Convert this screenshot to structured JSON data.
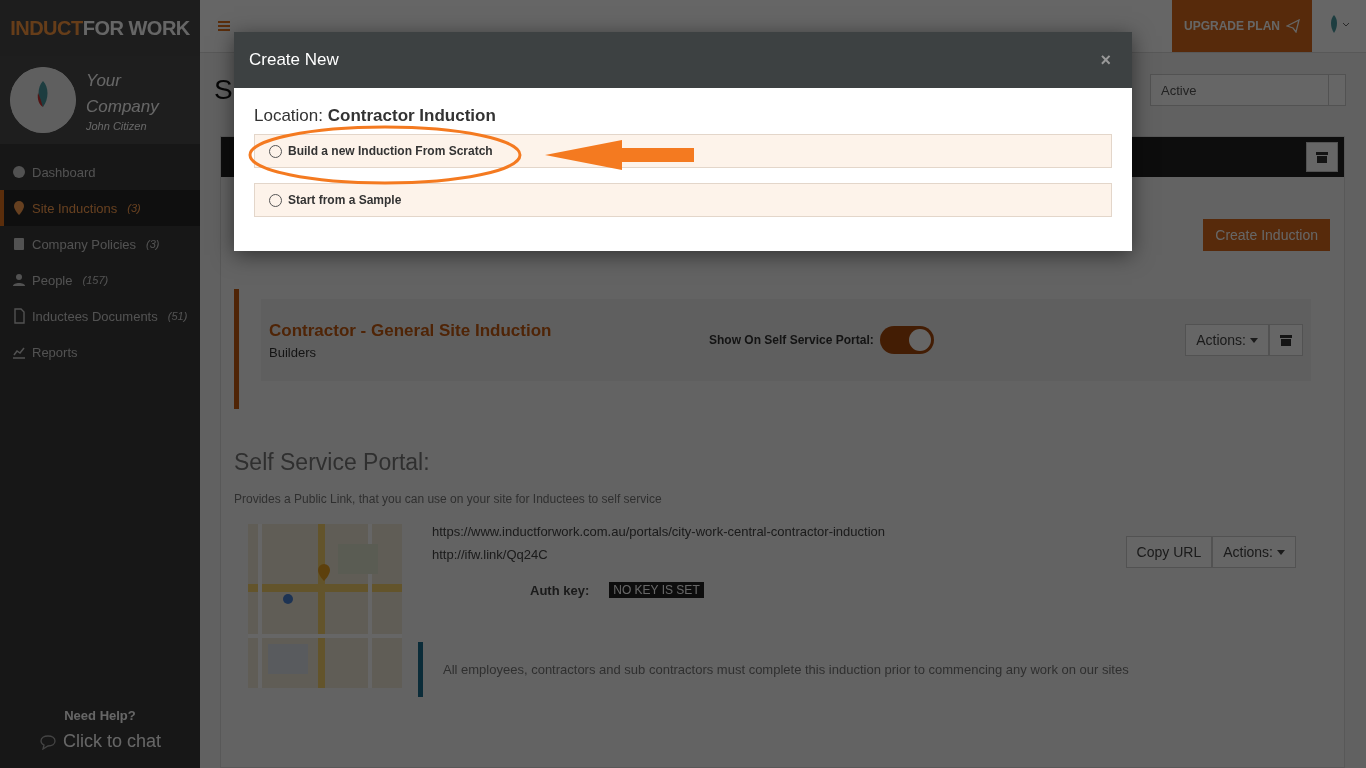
{
  "brand": {
    "part_1": "INDUCT",
    "part_2": "FOR WORK"
  },
  "profile": {
    "company": "Your Company",
    "user": "John Citizen"
  },
  "nav": [
    {
      "label": "Dashboard",
      "selected": false
    },
    {
      "label": "Site Inductions",
      "count": "(3)",
      "selected": true
    },
    {
      "label": "Company Policies",
      "count": "(3)",
      "selected": false
    },
    {
      "label": "People",
      "count": "(157)",
      "selected": false
    },
    {
      "label": "Inductees Documents",
      "count": "(51)",
      "selected": false
    },
    {
      "label": "Reports",
      "selected": false
    }
  ],
  "help": {
    "title": "Need Help?",
    "chat": "Click to chat"
  },
  "header": {
    "upgrade": "UPGRADE PLAN"
  },
  "page": {
    "title": "S",
    "status": "Active",
    "create": "Create Induction"
  },
  "induction": {
    "title": "Contractor - General Site Induction",
    "subtitle": "Builders",
    "portal_label": "Show On Self Service Portal:",
    "portal_on": true,
    "actions": "Actions:"
  },
  "portal": {
    "heading": "Self Service Portal:",
    "description": "Provides a Public Link, that you can use on your site for Inductees to self service",
    "url": "https://www.inductforwork.com.au/portals/city-work-central-contractor-induction",
    "short_url": "http://ifw.link/Qq24C",
    "auth_label": "Auth key:",
    "auth_value": "NO KEY IS SET",
    "copy": "Copy URL",
    "actions": "Actions:",
    "note": "All employees, contractors and sub contractors must complete this induction prior to commencing any work on our sites"
  },
  "modal": {
    "title": "Create New",
    "close": "×",
    "location": "Location: **Contractor Induction**",
    "options": [
      {
        "label": "Build a new Induction From Scratch",
        "selected": false
      },
      {
        "label": "Start from a Sample",
        "selected": false
      }
    ]
  }
}
